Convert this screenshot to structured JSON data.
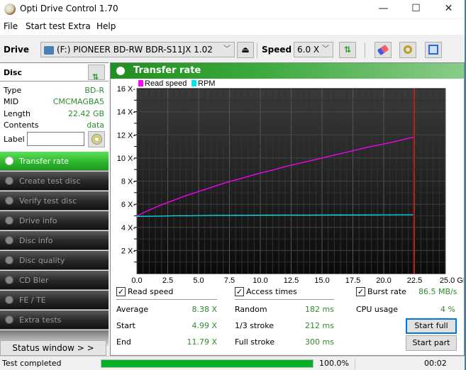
{
  "window": {
    "title": "Opti Drive Control 1.70",
    "minimize": "—",
    "maximize": "☐",
    "close": "✕"
  },
  "menu": [
    "File",
    "Start test",
    "Extra",
    "Help"
  ],
  "toolbar": {
    "drive_label": "Drive",
    "drive_value": "(F:)  PIONEER BD-RW  BDR-S11JX 1.02",
    "speed_label": "Speed",
    "speed_value": "6.0 X",
    "eject_icon": "⏏",
    "refresh_icon": "⇅",
    "erase_icon": "eraser",
    "config_icon": "gears",
    "save_icon": "💾"
  },
  "disc": {
    "header": "Disc",
    "rows": [
      {
        "key": "Type",
        "value": "BD-R"
      },
      {
        "key": "MID",
        "value": "CMCMAGBA5"
      },
      {
        "key": "Length",
        "value": "22.42 GB"
      },
      {
        "key": "Contents",
        "value": "data"
      }
    ],
    "label_key": "Label",
    "label_value": ""
  },
  "nav": [
    {
      "label": "Transfer rate",
      "active": true
    },
    {
      "label": "Create test disc",
      "active": false
    },
    {
      "label": "Verify test disc",
      "active": false
    },
    {
      "label": "Drive info",
      "active": false
    },
    {
      "label": "Disc info",
      "active": false
    },
    {
      "label": "Disc quality",
      "active": false
    },
    {
      "label": "CD Bler",
      "active": false
    },
    {
      "label": "FE / TE",
      "active": false
    },
    {
      "label": "Extra tests",
      "active": false
    }
  ],
  "status_window_button": "Status window > >",
  "panel": {
    "title": "Transfer rate"
  },
  "chart_data": {
    "type": "line",
    "title": "Transfer rate",
    "xlabel": "GB",
    "ylabel": "",
    "xlim": [
      0,
      25
    ],
    "ylim": [
      0,
      16
    ],
    "x_ticks": [
      "0.0",
      "2.5",
      "5.0",
      "7.5",
      "10.0",
      "12.5",
      "15.0",
      "17.5",
      "20.0",
      "22.5",
      "25.0 GB"
    ],
    "y_ticks": [
      "2 X",
      "4 X",
      "6 X",
      "8 X",
      "10 X",
      "12 X",
      "14 X",
      "16 X"
    ],
    "grid": true,
    "legend": "top-left",
    "end_marker_gb": 22.42,
    "series": [
      {
        "name": "Read speed",
        "color": "#ff00ff",
        "x": [
          0,
          1,
          2,
          3,
          4,
          5,
          6,
          7,
          8,
          9,
          10,
          11,
          12,
          13,
          14,
          15,
          16,
          17,
          18,
          19,
          20,
          21,
          22,
          22.42
        ],
        "y": [
          4.99,
          5.5,
          5.95,
          6.35,
          6.75,
          7.1,
          7.45,
          7.8,
          8.1,
          8.4,
          8.7,
          8.95,
          9.25,
          9.5,
          9.75,
          10.0,
          10.25,
          10.5,
          10.75,
          11.0,
          11.2,
          11.45,
          11.7,
          11.79
        ]
      },
      {
        "name": "RPM",
        "color": "#00e5ee",
        "x": [
          0,
          1,
          2,
          3,
          4,
          5,
          6,
          8,
          10,
          12,
          14,
          16,
          18,
          20,
          22,
          22.42
        ],
        "y": [
          4.95,
          4.96,
          4.97,
          5.0,
          5.0,
          5.02,
          5.03,
          5.04,
          5.05,
          5.06,
          5.06,
          5.07,
          5.07,
          5.08,
          5.09,
          5.09
        ]
      }
    ]
  },
  "stats": {
    "read_speed_label": "Read speed",
    "access_times_label": "Access times",
    "burst_rate_label": "Burst rate",
    "burst_rate_value": "86.5 MB/s",
    "cpu_label": "CPU usage",
    "cpu_value": "4 %",
    "read": [
      {
        "key": "Average",
        "value": "8.38 X"
      },
      {
        "key": "Start",
        "value": "4.99 X"
      },
      {
        "key": "End",
        "value": "11.79 X"
      }
    ],
    "access": [
      {
        "key": "Random",
        "value": "182 ms"
      },
      {
        "key": "1/3 stroke",
        "value": "212 ms"
      },
      {
        "key": "Full stroke",
        "value": "300 ms"
      }
    ],
    "start_full": "Start full",
    "start_part": "Start part"
  },
  "statusbar": {
    "text": "Test completed",
    "progress_pct": 100,
    "progress_text": "100.0%",
    "elapsed": "00:02"
  }
}
